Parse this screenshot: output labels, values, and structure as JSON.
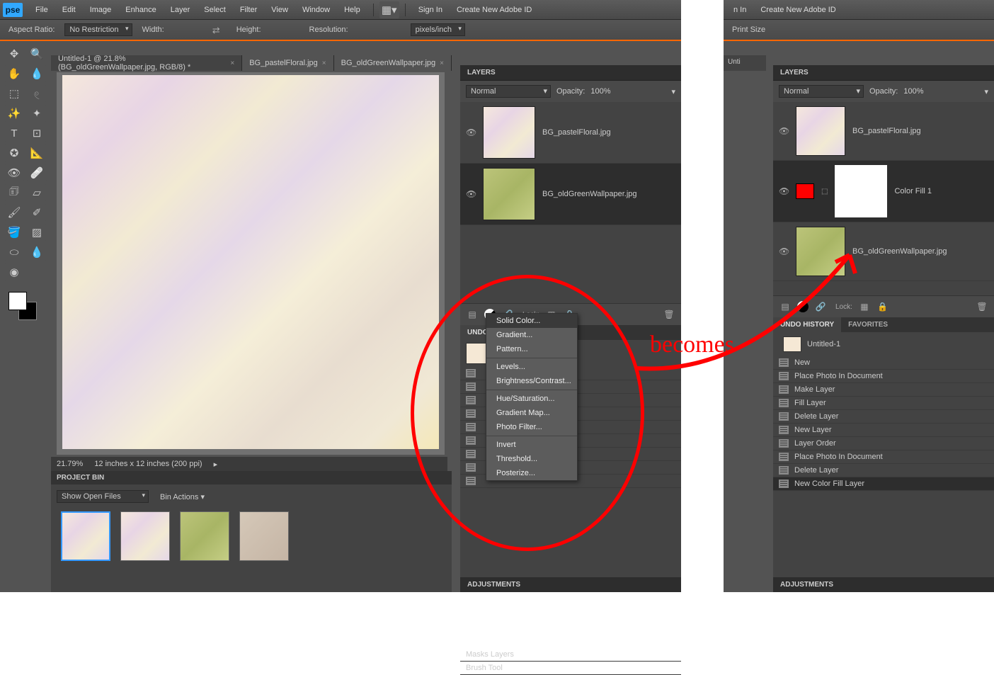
{
  "menu": [
    "File",
    "Edit",
    "Image",
    "Enhance",
    "Layer",
    "Select",
    "Filter",
    "View",
    "Window",
    "Help"
  ],
  "auth": {
    "signin": "Sign In",
    "create": "Create New Adobe ID"
  },
  "optbar": {
    "aspect": "Aspect Ratio:",
    "aspectval": "No Restriction",
    "width": "Width:",
    "height": "Height:",
    "res": "Resolution:",
    "resunit": "pixels/inch"
  },
  "tabs": [
    {
      "label": "Untitled-1 @ 21.8% (BG_oldGreenWallpaper.jpg, RGB/8) *",
      "active": true
    },
    {
      "label": "BG_pastelFloral.jpg",
      "active": false
    },
    {
      "label": "BG_oldGreenWallpaper.jpg",
      "active": false
    }
  ],
  "zoom": {
    "pct": "21.79%",
    "dims": "12 inches x 12 inches (200 ppi)"
  },
  "projectbin": {
    "title": "PROJECT BIN",
    "showfiles": "Show Open Files",
    "binactions": "Bin Actions"
  },
  "layers": {
    "title": "LAYERS",
    "blend": "Normal",
    "opacity_lbl": "Opacity:",
    "opacity": "100%",
    "lock": "Lock:"
  },
  "layers1": [
    {
      "name": "BG_pastelFloral.jpg",
      "cls": "pastel"
    },
    {
      "name": "BG_oldGreenWallpaper.jpg",
      "cls": "green",
      "sel": true
    }
  ],
  "layers2": [
    {
      "name": "BG_pastelFloral.jpg",
      "cls": "pastel"
    },
    {
      "name": "Color Fill 1",
      "fill": true,
      "sel": true
    },
    {
      "name": "BG_oldGreenWallpaper.jpg",
      "cls": "green"
    }
  ],
  "popup": {
    "groups": [
      [
        "Solid Color...",
        "Gradient...",
        "Pattern..."
      ],
      [
        "Levels...",
        "Brightness/Contrast..."
      ],
      [
        "Hue/Saturation...",
        "Gradient Map...",
        "Photo Filter..."
      ],
      [
        "Invert",
        "Threshold...",
        "Posterize..."
      ]
    ]
  },
  "undo1": {
    "tab": "UNDO",
    "items": [
      "Masks Layers",
      "Brush Tool"
    ]
  },
  "undo2": {
    "tabs": [
      "UNDO HISTORY",
      "FAVORITES"
    ],
    "doc": "Untitled-1",
    "items": [
      "New",
      "Place Photo In Document",
      "Make Layer",
      "Fill Layer",
      "Delete Layer",
      "New Layer",
      "Layer Order",
      "Place Photo In Document",
      "Delete Layer",
      "New Color Fill Layer"
    ]
  },
  "adjustments": "ADJUSTMENTS",
  "annot": {
    "becomes": "becomes"
  },
  "app2": {
    "tab_small": "Unti",
    "signin_part": "n In",
    "printsize": "Print Size"
  }
}
